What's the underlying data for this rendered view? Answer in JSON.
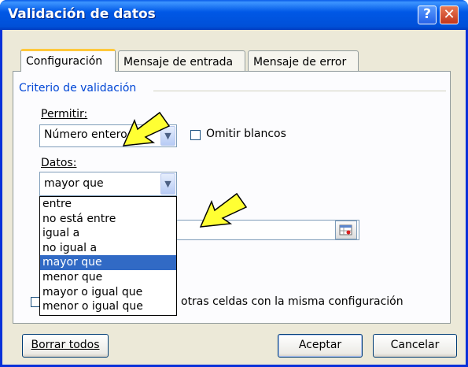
{
  "window": {
    "title": "Validación de datos",
    "help_glyph": "?",
    "close_glyph": "✕"
  },
  "tabs": [
    {
      "label": "Configuración",
      "active": true
    },
    {
      "label": "Mensaje de entrada",
      "active": false
    },
    {
      "label": "Mensaje de error",
      "active": false
    }
  ],
  "criteria": {
    "group_title": "Criterio de validación",
    "permitir_label": "Permitir:",
    "permitir_value": "Número entero",
    "omitir_label": "Omitir blancos",
    "datos_label": "Datos:",
    "datos_value": "mayor que",
    "datos_options": [
      "entre",
      "no está entre",
      "igual a",
      "no igual a",
      "mayor que",
      "menor que",
      "mayor o igual que",
      "menor o igual que"
    ],
    "datos_selected_index": 4,
    "apply_label": "otras celdas con la misma configuración"
  },
  "buttons": {
    "clear": "Borrar todos",
    "ok": "Aceptar",
    "cancel": "Cancelar"
  },
  "colors": {
    "titlebar": "#0058e6",
    "selection": "#316ac5",
    "group_title": "#0046d5",
    "arrow": "#ffff33"
  }
}
